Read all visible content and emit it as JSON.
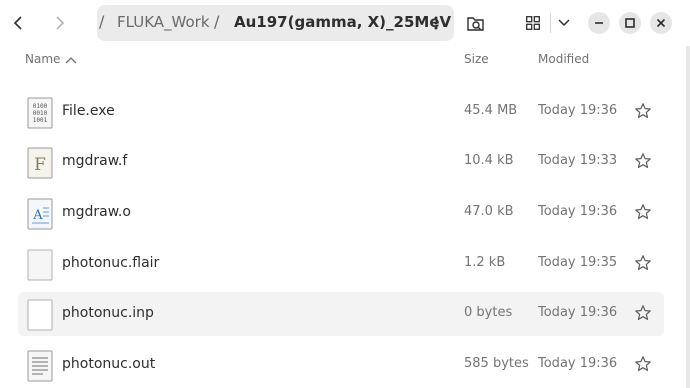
{
  "header": {
    "path": [
      "FLUKA_Work",
      "Au197(gamma, X)_25MeV"
    ]
  },
  "columns": {
    "name": "Name",
    "size": "Size",
    "modified": "Modified"
  },
  "files": [
    {
      "name": "File.exe",
      "size": "45.4 MB",
      "modified": "Today 19:36",
      "icon": "binary-file-icon"
    },
    {
      "name": "mgdraw.f",
      "size": "10.4 kB",
      "modified": "Today 19:33",
      "icon": "fortran-file-icon"
    },
    {
      "name": "mgdraw.o",
      "size": "47.0 kB",
      "modified": "Today 19:36",
      "icon": "object-file-icon"
    },
    {
      "name": "photonuc.flair",
      "size": "1.2 kB",
      "modified": "Today 19:35",
      "icon": "generic-file-icon"
    },
    {
      "name": "photonuc.inp",
      "size": "0 bytes",
      "modified": "Today 19:36",
      "icon": "generic-file-icon"
    },
    {
      "name": "photonuc.out",
      "size": "585 bytes",
      "modified": "Today 19:36",
      "icon": "text-file-icon"
    }
  ]
}
